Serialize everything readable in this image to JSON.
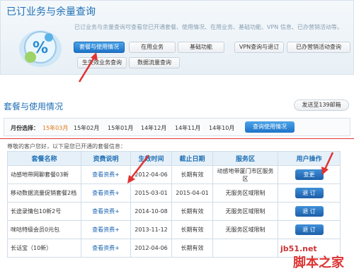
{
  "top": {
    "title": "已订业务与余量查询",
    "description": "已订业务与余量查询可查看您已开通套餐、使用情况、在用业务、基础功能、VPN 信息、已办营销活动等。",
    "buttons": [
      {
        "label": "套餐与使用情况",
        "active": true
      },
      {
        "label": "在用业务",
        "active": false
      },
      {
        "label": "基础功能",
        "active": false
      },
      {
        "label": "VPN查询与退订",
        "active": false
      },
      {
        "label": "已办营销活动查询",
        "active": false
      },
      {
        "label": "生失效业务查询",
        "active": false
      },
      {
        "label": "数据流量查询",
        "active": false
      }
    ]
  },
  "section": {
    "title": "套餐与使用情况",
    "send_label": "发送至139邮箱"
  },
  "months": {
    "label": "月份选择：",
    "items": [
      "15年03月",
      "15年02月",
      "15年01月",
      "14年12月",
      "14年11月",
      "14年10月"
    ],
    "selected": "15年03月",
    "query_label": "查询使用情况"
  },
  "notice": "尊敬的客户您好，以下是您已开通的套餐信息：",
  "table": {
    "headers": [
      "套餐名称",
      "资费说明",
      "生效时间",
      "截止日期",
      "服务区",
      "用户操作"
    ],
    "rows": [
      {
        "name": "动感地带网聊套餐03新",
        "fee": "查看资费+",
        "start": "2012-04-06",
        "end": "长期有效",
        "area": "动感地带厦门市区服务区",
        "action": "变更"
      },
      {
        "name": "移动数据流量促销套餐2档",
        "fee": "查看资费+",
        "start": "2015-03-01",
        "end": "2015-04-01",
        "area": "无服务区域限制",
        "action": "退 订"
      },
      {
        "name": "长途录情包10新2号",
        "fee": "查看资费+",
        "start": "2014-10-08",
        "end": "长期有效",
        "area": "无服务区域限制",
        "action": "退 订"
      },
      {
        "name": "咪咕特级会员0元包",
        "fee": "查看资费+",
        "start": "2013-11-12",
        "end": "长期有效",
        "area": "无服务区域限制",
        "action": "退 订"
      },
      {
        "name": "长话宝（10新）",
        "fee": "查看资费+",
        "start": "2012-04-06",
        "end": "长期有效",
        "area": "",
        "action": ""
      }
    ]
  },
  "watermark": {
    "line1": "jb51.net",
    "line2": "脚本之家"
  },
  "colors": {
    "accent": "#1f6fb5",
    "selected_month": "#e47a1a",
    "arrow": "#e03333"
  }
}
